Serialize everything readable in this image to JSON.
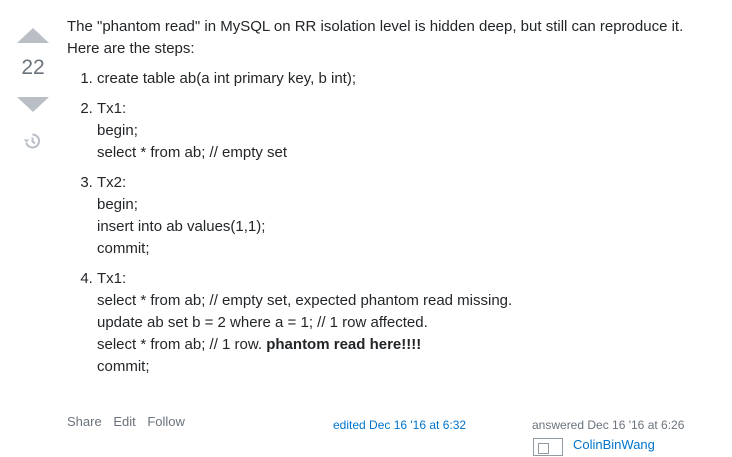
{
  "vote": {
    "count": "22"
  },
  "post": {
    "intro": "The \"phantom read\" in MySQL on RR isolation level is hidden deep, but still can reproduce it. Here are the steps:",
    "steps": [
      {
        "lines": [
          "create table ab(a int primary key, b int);"
        ]
      },
      {
        "lines": [
          "Tx1:",
          "begin;",
          "select * from ab; // empty set"
        ]
      },
      {
        "lines": [
          "Tx2:",
          "begin;",
          "insert into ab values(1,1);",
          "commit;"
        ]
      },
      {
        "lines": [
          "Tx1:",
          "select * from ab; // empty set, expected phantom read missing.",
          "update ab set b = 2 where a = 1; // 1 row affected."
        ],
        "last_prefix": "select * from ab; // 1 row. ",
        "last_bold": "phantom read here!!!!",
        "final": "commit;"
      }
    ]
  },
  "menu": {
    "share": "Share",
    "edit": "Edit",
    "follow": "Follow"
  },
  "edited": "edited Dec 16 '16 at 6:32",
  "answered": "answered Dec 16 '16 at 6:26",
  "user": {
    "name": "ColinBinWang"
  }
}
